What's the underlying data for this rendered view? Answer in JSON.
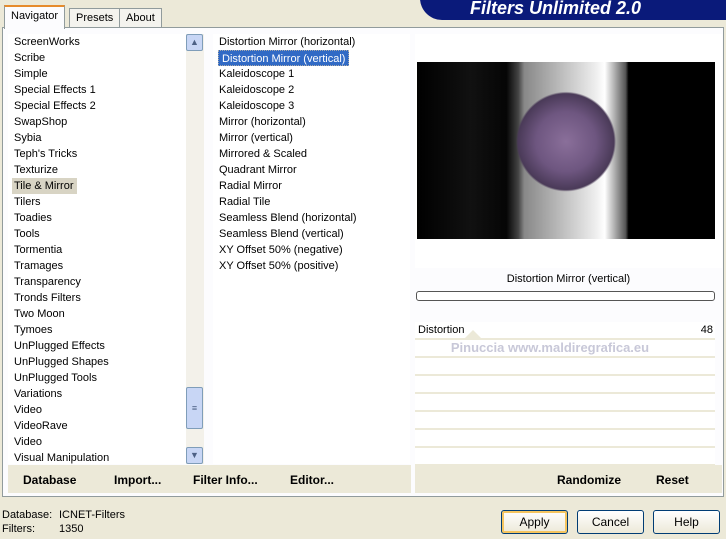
{
  "title": "Filters Unlimited 2.0",
  "tabs": [
    "Navigator",
    "Presets",
    "About"
  ],
  "categories": [
    "ScreenWorks",
    "Scribe",
    "Simple",
    "Special Effects 1",
    "Special Effects 2",
    "SwapShop",
    "Sybia",
    "Teph's Tricks",
    "Texturize",
    "Tile & Mirror",
    "Tilers",
    "Toadies",
    "Tools",
    "Tormentia",
    "Tramages",
    "Transparency",
    "Tronds Filters",
    "Two Moon",
    "Tymoes",
    "UnPlugged Effects",
    "UnPlugged Shapes",
    "UnPlugged Tools",
    "Variations",
    "Video",
    "VideoRave",
    "Video",
    "Visual Manipulation"
  ],
  "selected_category": "Tile & Mirror",
  "filters": [
    "Distortion Mirror (horizontal)",
    "Distortion Mirror (vertical)",
    "Kaleidoscope 1",
    "Kaleidoscope 2",
    "Kaleidoscope 3",
    "Mirror (horizontal)",
    "Mirror (vertical)",
    "Mirrored & Scaled",
    "Quadrant Mirror",
    "Radial Mirror",
    "Radial Tile",
    "Seamless Blend (horizontal)",
    "Seamless Blend (vertical)",
    "XY Offset 50% (negative)",
    "XY Offset 50% (positive)"
  ],
  "selected_filter": "Distortion Mirror (vertical)",
  "preview": {
    "filter_name": "Distortion Mirror (vertical)",
    "watermark": "Pinuccia www.maldiregrafica.eu"
  },
  "params": [
    {
      "label": "Distortion",
      "value": "48"
    }
  ],
  "left_buttons": {
    "database": "Database",
    "import": "Import...",
    "filter_info": "Filter Info...",
    "editor": "Editor..."
  },
  "right_buttons": {
    "randomize": "Randomize",
    "reset": "Reset"
  },
  "status": {
    "database_label": "Database:",
    "database_value": "ICNET-Filters",
    "filters_label": "Filters:",
    "filters_value": "1350"
  },
  "dialog_buttons": {
    "apply": "Apply",
    "cancel": "Cancel",
    "help": "Help"
  }
}
